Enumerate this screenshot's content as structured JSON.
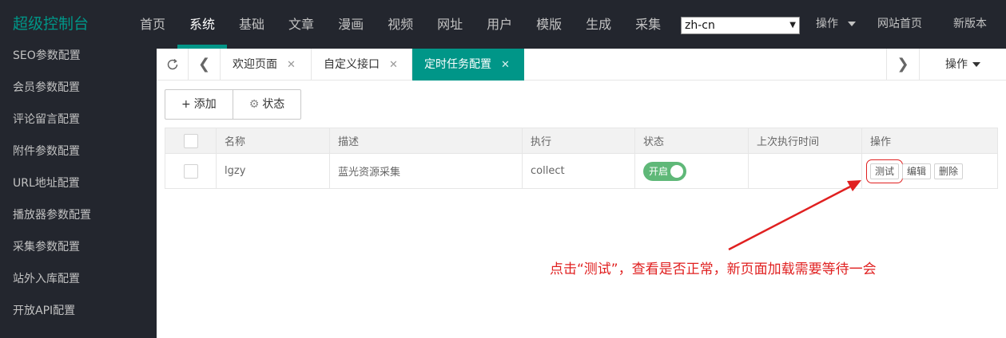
{
  "header": {
    "logo": "超级控制台",
    "nav": [
      "首页",
      "系统",
      "基础",
      "文章",
      "漫画",
      "视频",
      "网址",
      "用户",
      "模版",
      "生成",
      "采集"
    ],
    "active_nav": "系统",
    "lang_value": "zh-cn",
    "ops_label": "操作",
    "site_home": "网站首页",
    "new_version": "新版本"
  },
  "sidebar": {
    "items": [
      "SEO参数配置",
      "会员参数配置",
      "评论留言配置",
      "附件参数配置",
      "URL地址配置",
      "播放器参数配置",
      "采集参数配置",
      "站外入库配置",
      "开放API配置"
    ]
  },
  "tabs": {
    "items": [
      {
        "label": "欢迎页面",
        "close": "✕",
        "active": false
      },
      {
        "label": "自定义接口",
        "close": "✕",
        "active": false
      },
      {
        "label": "定时任务配置",
        "close": "✕",
        "active": true
      }
    ],
    "ops_label": "操作"
  },
  "toolbar": {
    "add_icon": "+",
    "add_label": "添加",
    "status_icon": "⚙",
    "status_label": "状态"
  },
  "table": {
    "headers": [
      "名称",
      "描述",
      "执行",
      "状态",
      "上次执行时间",
      "操作"
    ],
    "rows": [
      {
        "name": "lgzy",
        "desc": "蓝光资源采集",
        "exec": "collect",
        "status": "开启",
        "last_run": "",
        "actions": [
          "测试",
          "编辑",
          "删除"
        ]
      }
    ]
  },
  "annotation": {
    "text": "点击“测试”，查看是否正常，新页面加载需要等待一会",
    "color": "#e02020"
  },
  "colors": {
    "dark_bg": "#23262e",
    "accent": "#009688",
    "switch_on": "#5fb878"
  },
  "icons": {
    "refresh": "refresh-icon",
    "prev": "chevron-left-icon",
    "next": "chevron-right-icon",
    "add": "plus-icon",
    "status": "gear-icon"
  }
}
